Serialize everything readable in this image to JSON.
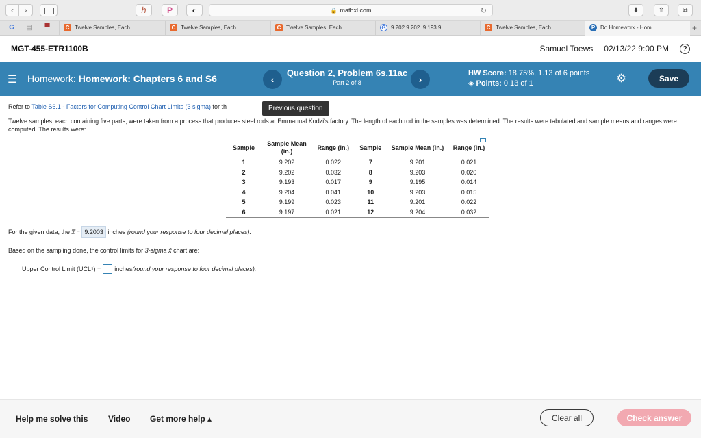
{
  "browser": {
    "url": "mathxl.com",
    "ext1": "ℎ",
    "ext2": "P",
    "tabs": [
      {
        "label": "Twelve Samples, Each...",
        "icon": "C"
      },
      {
        "label": "Twelve Samples, Each...",
        "icon": "C"
      },
      {
        "label": "Twelve Samples, Each...",
        "icon": "C"
      },
      {
        "label": "9.202 9.202. 9.193 9....",
        "icon": "G"
      },
      {
        "label": "Twelve Samples, Each...",
        "icon": "C"
      },
      {
        "label": "Do Homework - Hom...",
        "icon": "P"
      }
    ]
  },
  "header": {
    "course": "MGT-455-ETR1100B",
    "user": "Samuel Toews",
    "datetime": "02/13/22 9:00 PM"
  },
  "hwbar": {
    "prefix": "Homework: ",
    "title": "Homework: Chapters 6 and S6",
    "question": "Question 2, Problem 6s.11ac",
    "part": "Part 2 of 8",
    "score_label": "HW Score:",
    "score_value": "18.75%, 1.13 of 6 points",
    "points_label": "Points:",
    "points_value": "0.13 of 1",
    "save": "Save"
  },
  "tooltip": "Previous question",
  "content": {
    "refer_prefix": "Refer to ",
    "refer_link": "Table S6.1 - Factors for Computing Control Chart Limits (3 sigma)",
    "refer_suffix": " for th",
    "description": "Twelve samples, each containing five parts, were taken from a process that produces steel rods at Emmanual Kodzi's factory. The length of each rod in the samples was determined. The results were tabulated and sample means and ranges were computed. The results were:",
    "table": {
      "headers": [
        "Sample",
        "Sample Mean (in.)",
        "Range (in.)",
        "Sample",
        "Sample Mean (in.)",
        "Range (in.)"
      ],
      "rows": [
        [
          "1",
          "9.202",
          "0.022",
          "7",
          "9.201",
          "0.021"
        ],
        [
          "2",
          "9.202",
          "0.032",
          "8",
          "9.203",
          "0.020"
        ],
        [
          "3",
          "9.193",
          "0.017",
          "9",
          "9.195",
          "0.014"
        ],
        [
          "4",
          "9.204",
          "0.041",
          "10",
          "9.203",
          "0.015"
        ],
        [
          "5",
          "9.199",
          "0.023",
          "11",
          "9.201",
          "0.022"
        ],
        [
          "6",
          "9.197",
          "0.021",
          "12",
          "9.204",
          "0.032"
        ]
      ]
    },
    "given_prefix": "For the given data, the ",
    "xbarbar": "x̿",
    "given_eq": " = ",
    "given_answer": "9.2003",
    "given_suffix": " inches ",
    "given_note": "(round your response to four decimal places).",
    "limits_prefix": "Based on the sampling done, the control limits for ",
    "limits_italic": "3-sigma x̄",
    "limits_suffix": " chart are:",
    "ucl_label": "Upper Control Limit (UCL",
    "ucl_sub": "x̄",
    "ucl_eq": ") = ",
    "ucl_units": " inches ",
    "ucl_note": "(round your response to four decimal places)."
  },
  "footer": {
    "help": "Help me solve this",
    "video": "Video",
    "more_help": "Get more help ▴",
    "clear": "Clear all",
    "check": "Check answer"
  }
}
